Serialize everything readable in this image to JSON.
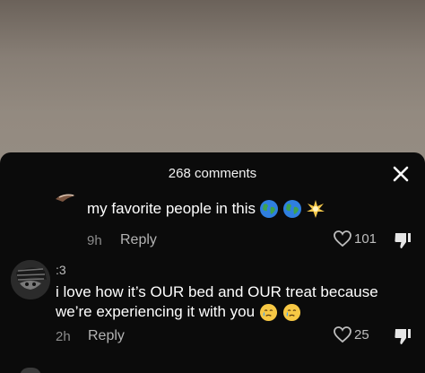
{
  "sheet": {
    "title": "268 comments"
  },
  "comments": [
    {
      "text": "my favorite people in this",
      "emojis": [
        "globe-icon",
        "globe-icon",
        "sparkle-star-icon"
      ],
      "time": "9h",
      "reply_label": "Reply",
      "likes": "101"
    },
    {
      "username": ":3",
      "text": "i love how it’s OUR bed and OUR treat because we’re experiencing it with you",
      "emojis": [
        "crying-face-icon",
        "crying-face-icon"
      ],
      "time": "2h",
      "reply_label": "Reply",
      "likes": "25"
    }
  ],
  "colors": {
    "sheet_bg": "#0b0b0b",
    "video_bg": "#8a8179",
    "text_primary": "#ffffff",
    "text_secondary": "#8c8c8c"
  }
}
